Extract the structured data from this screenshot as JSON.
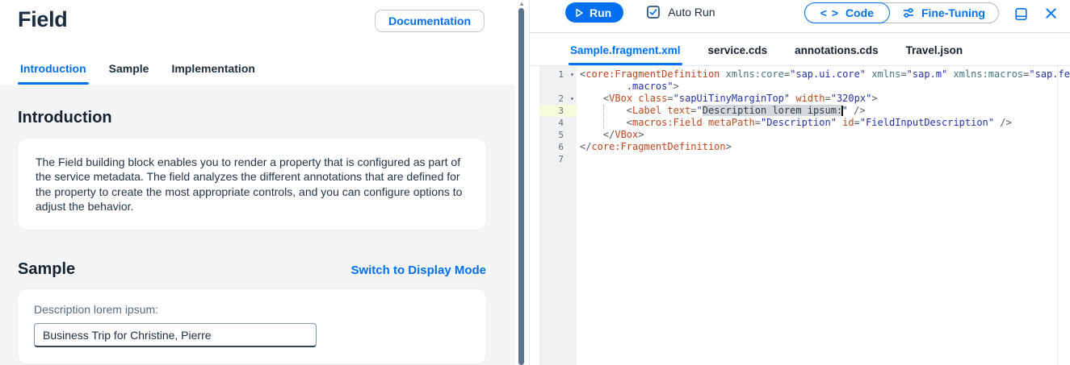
{
  "colors": {
    "accent": "#0070f2",
    "text_dark": "#1d2d3e",
    "text_gray": "#556b82",
    "panel_gray": "#f4f5f6",
    "run_button_bg": "#0070f2",
    "gutter_bg": "#f0f1f2",
    "gutter_active_bg": "#f8fade",
    "code_tag": "#c0441e",
    "code_xmlns_attr": "#45747e",
    "code_string": "#2431a6",
    "code_punctuation": "#4e5c66",
    "code_selection_bg": "#d5d8da",
    "scrollbar_thumb": "#5b738b"
  },
  "icons": {
    "play-icon": "play-triangle",
    "check-icon": "checkmark",
    "code-brackets-icon": "< >",
    "sliders-icon": "fine-tuning-sliders",
    "split-screen-icon": "split-panel",
    "close-icon": "✕",
    "fold-icon": "▾",
    "scroll-up-icon": "▲"
  },
  "left": {
    "title": "Field",
    "documentation_button": "Documentation",
    "tabs": [
      {
        "label": "Introduction",
        "active": true
      },
      {
        "label": "Sample",
        "active": false
      },
      {
        "label": "Implementation",
        "active": false
      }
    ],
    "intro": {
      "heading": "Introduction",
      "body": "The Field building block enables you to render a property that is configured as part of the service metadata. The field analyzes the different annotations that are defined for the property to create the most appropriate controls, and you can configure options to adjust the behavior."
    },
    "sample": {
      "heading": "Sample",
      "mode_link": "Switch to Display Mode",
      "field_label": "Description lorem ipsum:",
      "field_value": "Business Trip for Christine, Pierre"
    }
  },
  "editor": {
    "toolbar": {
      "run_label": "Run",
      "auto_run_label": "Auto Run",
      "auto_run_checked": true,
      "code_label": "Code",
      "fine_tuning_label": "Fine-Tuning"
    },
    "tabs": [
      {
        "label": "Sample.fragment.xml",
        "active": true
      },
      {
        "label": "service.cds",
        "active": false
      },
      {
        "label": "annotations.cds",
        "active": false
      },
      {
        "label": "Travel.json",
        "active": false
      }
    ],
    "code": {
      "language": "xml",
      "rows": [
        {
          "num": "1",
          "fold": true,
          "active": false,
          "tokens": [
            [
              "p",
              "<"
            ],
            [
              "t",
              "core:FragmentDefinition"
            ],
            [
              "x",
              " xmlns:core"
            ],
            [
              "p",
              "="
            ],
            [
              "s",
              "\"sap.ui.core\""
            ],
            [
              "x",
              " xmlns"
            ],
            [
              "p",
              "="
            ],
            [
              "s",
              "\"sap.m\""
            ],
            [
              "x",
              " xmlns:macros"
            ],
            [
              "p",
              "="
            ],
            [
              "s",
              "\"sap.fe"
            ]
          ]
        },
        {
          "num": "",
          "fold": false,
          "active": false,
          "tokens": [
            [
              "w",
              "        "
            ],
            [
              "s",
              ".macros\""
            ],
            [
              "p",
              ">"
            ]
          ]
        },
        {
          "num": "2",
          "fold": true,
          "active": false,
          "tokens": [
            [
              "w",
              "    "
            ],
            [
              "p",
              "<"
            ],
            [
              "t",
              "VBox"
            ],
            [
              "a",
              " class"
            ],
            [
              "p",
              "="
            ],
            [
              "s",
              "\"sapUiTinyMarginTop\""
            ],
            [
              "a",
              " width"
            ],
            [
              "p",
              "="
            ],
            [
              "s",
              "\"320px\""
            ],
            [
              "p",
              ">"
            ]
          ]
        },
        {
          "num": "3",
          "fold": false,
          "active": true,
          "tokens": [
            [
              "w",
              "        "
            ],
            [
              "p",
              "<"
            ],
            [
              "t",
              "Label"
            ],
            [
              "a",
              " text"
            ],
            [
              "p",
              "="
            ],
            [
              "s",
              "\""
            ],
            [
              "sel",
              "Description lorem ipsum:"
            ],
            [
              "cur",
              ""
            ],
            [
              "s",
              "\""
            ],
            [
              "p",
              " />"
            ]
          ]
        },
        {
          "num": "4",
          "fold": false,
          "active": false,
          "tokens": [
            [
              "w",
              "        "
            ],
            [
              "p",
              "<"
            ],
            [
              "t",
              "macros:Field"
            ],
            [
              "a",
              " metaPath"
            ],
            [
              "p",
              "="
            ],
            [
              "s",
              "\"Description\""
            ],
            [
              "a",
              " id"
            ],
            [
              "p",
              "="
            ],
            [
              "s",
              "\"FieldInputDescription\""
            ],
            [
              "p",
              " />"
            ]
          ]
        },
        {
          "num": "5",
          "fold": false,
          "active": false,
          "tokens": [
            [
              "w",
              "    "
            ],
            [
              "p",
              "</"
            ],
            [
              "t",
              "VBox"
            ],
            [
              "p",
              ">"
            ]
          ]
        },
        {
          "num": "6",
          "fold": false,
          "active": false,
          "tokens": [
            [
              "p",
              "</"
            ],
            [
              "t",
              "core:FragmentDefinition"
            ],
            [
              "p",
              ">"
            ]
          ]
        },
        {
          "num": "7",
          "fold": false,
          "active": false,
          "tokens": []
        }
      ]
    }
  }
}
